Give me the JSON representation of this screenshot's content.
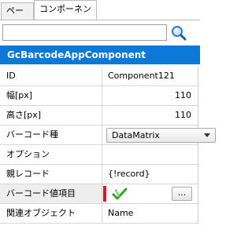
{
  "tabs": {
    "page": "ページ",
    "component": "コンポーネント"
  },
  "search": {
    "value": "",
    "placeholder": ""
  },
  "header": {
    "title": "GcBarcodeAppComponent"
  },
  "properties": {
    "id": {
      "label": "ID",
      "value": "Component121"
    },
    "width": {
      "label": "幅[px]",
      "value": "110"
    },
    "height": {
      "label": "高さ[px]",
      "value": "110"
    },
    "barcode_type": {
      "label": "バーコード種",
      "value": "DataMatrix"
    },
    "options": {
      "label": "オプション",
      "value": ""
    },
    "parent_record": {
      "label": "親レコード",
      "value": "{!record}"
    },
    "barcode_value": {
      "label": "バーコード値項目",
      "button": "..."
    },
    "related_object": {
      "label": "関連オブジェクト",
      "value": "Name"
    }
  },
  "colors": {
    "header_bg": "#0c78d8",
    "required_marker": "#e8102d",
    "check_icon": "#2fa81f"
  },
  "icons": {
    "search": "search-icon",
    "check": "check-icon",
    "dropdown": "chevron-down-icon"
  }
}
